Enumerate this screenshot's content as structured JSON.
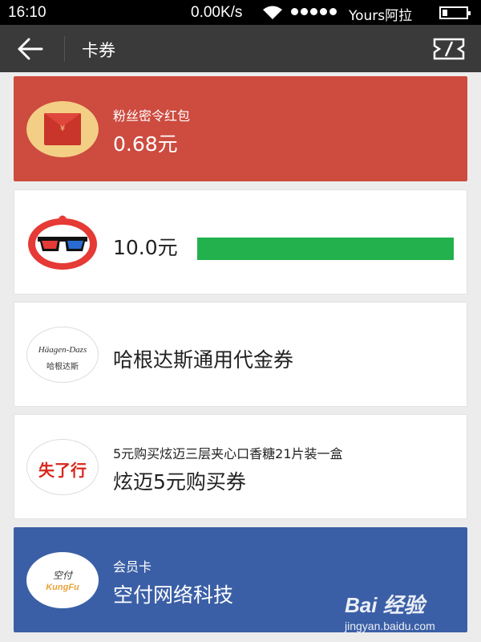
{
  "status_bar": {
    "time": "16:10",
    "network_speed": "0.00K/s",
    "carrier": "Yours阿拉"
  },
  "header": {
    "back_icon": "back-arrow-icon",
    "title": "卡券",
    "scan_icon": "scan-icon"
  },
  "cards": [
    {
      "subtitle": "粉丝密令红包",
      "title": "0.68元",
      "bg": "#cd4b3f",
      "icon": "red-envelope-icon"
    },
    {
      "subtitle": "",
      "title": "10.0元",
      "bg": "#ffffff",
      "icon": "3d-glasses-logo",
      "highlight_color": "#22b14c"
    },
    {
      "subtitle": "",
      "title": "哈根达斯通用代金券",
      "bg": "#ffffff",
      "icon": "haagen-dazs-logo",
      "logo_text": "Häagen-Dazs",
      "logo_subtext": "哈根达斯"
    },
    {
      "subtitle": "5元购买炫迈三层夹心口香糖21片装一盒",
      "title": "炫迈5元购买券",
      "bg": "#ffffff",
      "icon": "stride-gum-logo",
      "logo_text": "失了行"
    },
    {
      "subtitle": "会员卡",
      "title": "空付网络科技",
      "bg": "#3b5fa6",
      "icon": "kungfu-logo",
      "logo_text": "空付",
      "logo_subtext": "KungFu"
    }
  ],
  "watermark": {
    "brand": "Bai 经验",
    "site": "jingyan.baidu.com"
  }
}
